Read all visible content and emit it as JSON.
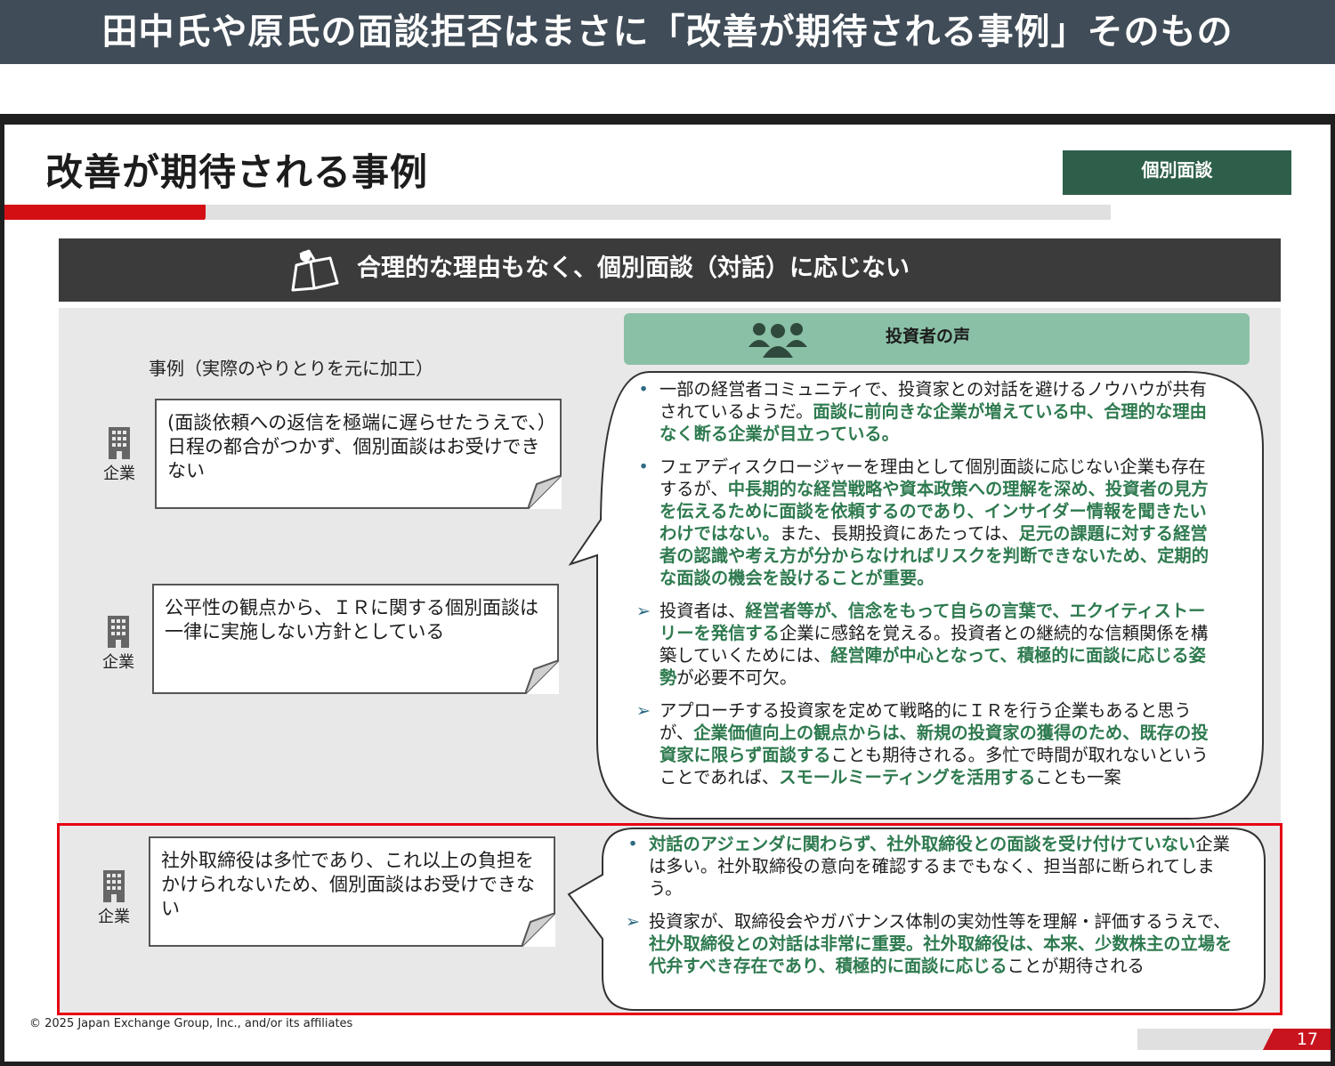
{
  "banner": {
    "title": "田中氏や原氏の面談拒否はまさに「改善が期待される事例」そのもの"
  },
  "slide": {
    "title": "改善が期待される事例",
    "badge": "個別面談",
    "header": "合理的な理由もなく、個別面談（対話）に応じない",
    "investor_head": "投資者の声",
    "case_label": "事例（実際のやりとりを元に加工）",
    "company_label": "企業",
    "cases": [
      "(面談依頼への返信を極端に遅らせたうえで、）日程の都合がつかず、個別面談はお受けできない",
      "公平性の観点から、ＩＲに関する個別面談は一律に実施しない方針としている",
      "社外取締役は多忙であり、これ以上の負担をかけられないため、個別面談はお受けできない"
    ],
    "voices_1": [
      {
        "marker": "•",
        "parts": [
          {
            "t": "一部の経営者コミュニティで、投資家との対話を避けるノウハウが共有されているようだ。",
            "b": false
          },
          {
            "t": "面談に前向きな企業が増えている中、合理的な理由なく断る企業が目立っている。",
            "b": true
          }
        ]
      },
      {
        "marker": "•",
        "parts": [
          {
            "t": "フェアディスクロージャーを理由として個別面談に応じない企業も存在するが、",
            "b": false
          },
          {
            "t": "中長期的な経営戦略や資本政策への理解を深め、投資者の見方を伝えるために面談を依頼するのであり、インサイダー情報を聞きたいわけではない。",
            "b": true
          },
          {
            "t": "また、長期投資にあたっては、",
            "b": false
          },
          {
            "t": "足元の課題に対する経営者の認識や考え方が分からなければリスクを判断できないため、定期的な面談の機会を設けることが重要。",
            "b": true
          }
        ]
      },
      {
        "marker": "➢",
        "parts": [
          {
            "t": "投資者は、",
            "b": false
          },
          {
            "t": "経営者等が、信念をもって自らの言葉で、エクイティストーリーを発信する",
            "b": true
          },
          {
            "t": "企業に感銘を覚える。投資者との継続的な信頼関係を構築していくためには、",
            "b": false
          },
          {
            "t": "経営陣が中心となって、積極的に面談に応じる姿勢",
            "b": true
          },
          {
            "t": "が必要不可欠。",
            "b": false
          }
        ]
      },
      {
        "marker": "➢",
        "parts": [
          {
            "t": "アプローチする投資家を定めて戦略的にＩＲを行う企業もあると思うが、",
            "b": false
          },
          {
            "t": "企業価値向上の観点からは、新規の投資家の獲得のため、既存の投資家に限らず面談する",
            "b": true
          },
          {
            "t": "ことも期待される。多忙で時間が取れないということであれば、",
            "b": false
          },
          {
            "t": "スモールミーティングを活用する",
            "b": true
          },
          {
            "t": "ことも一案",
            "b": false
          }
        ]
      }
    ],
    "voices_2": [
      {
        "marker": "•",
        "parts": [
          {
            "t": "対話のアジェンダに関わらず、社外取締役との面談を受け付けていない",
            "b": true
          },
          {
            "t": "企業は多い。社外取締役の意向を確認するまでもなく、担当部に断られてしまう。",
            "b": false
          }
        ]
      },
      {
        "marker": "➢",
        "parts": [
          {
            "t": "投資家が、取締役会やガバナンス体制の実効性等を理解・評価するうえで、",
            "b": false
          },
          {
            "t": "社外取締役との対話は非常に重要。社外取締役は、本来、少数株主の立場を代弁すべき存在であり、積極的に面談に応じる",
            "b": true
          },
          {
            "t": "ことが期待される",
            "b": false
          }
        ]
      }
    ],
    "copyright": "© 2025 Japan Exchange Group, Inc., and/or its affiliates",
    "page_number": "17"
  }
}
